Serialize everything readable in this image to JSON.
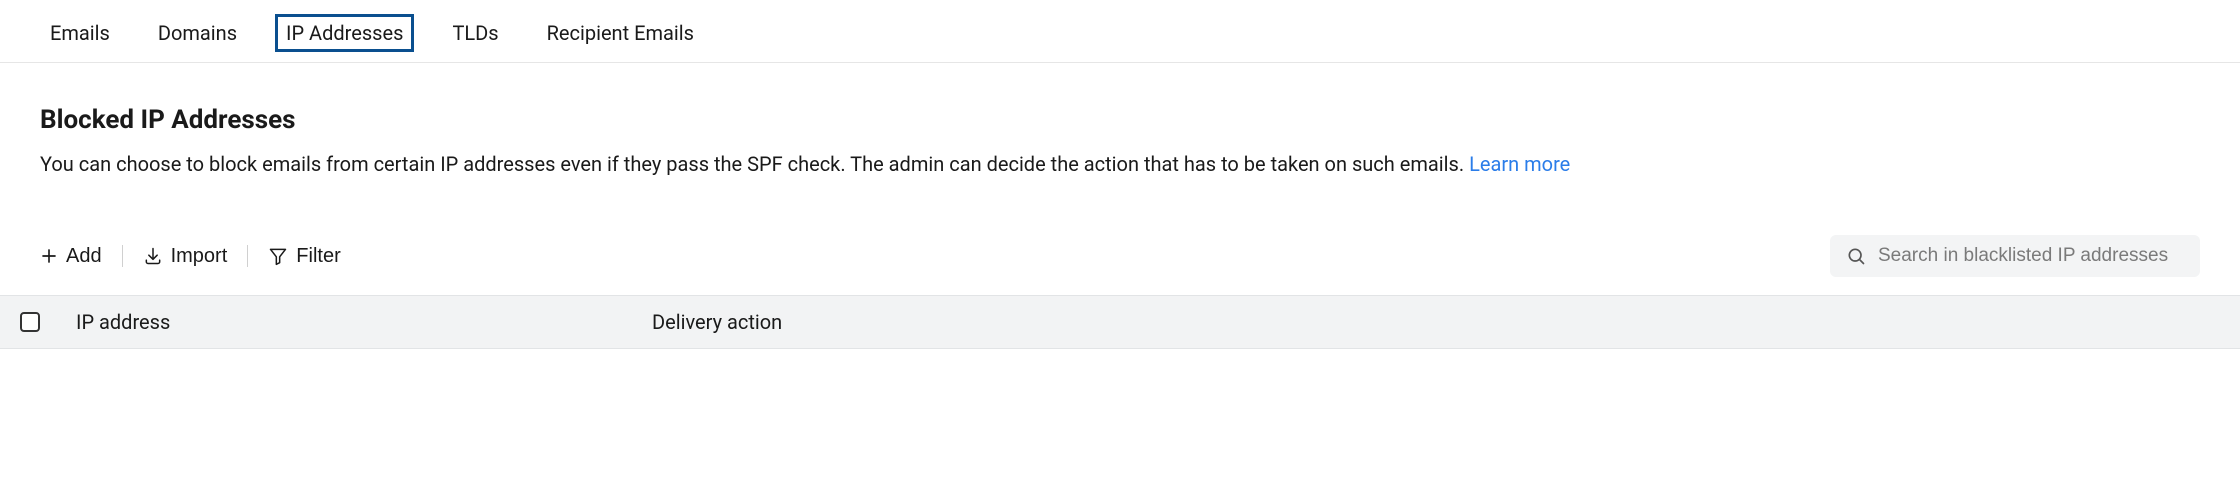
{
  "tabs": [
    {
      "label": "Emails"
    },
    {
      "label": "Domains"
    },
    {
      "label": "IP Addresses",
      "active": true
    },
    {
      "label": "TLDs"
    },
    {
      "label": "Recipient Emails"
    }
  ],
  "page": {
    "title": "Blocked IP Addresses",
    "description": "You can choose to block emails from certain IP addresses even if they pass the SPF check. The admin can decide the action that has to be taken on such emails.",
    "learn_more_label": "Learn more"
  },
  "toolbar": {
    "add_label": "Add",
    "import_label": "Import",
    "filter_label": "Filter",
    "search_placeholder": "Search in blacklisted IP addresses"
  },
  "table": {
    "columns": {
      "ip": "IP address",
      "action": "Delivery action"
    }
  }
}
